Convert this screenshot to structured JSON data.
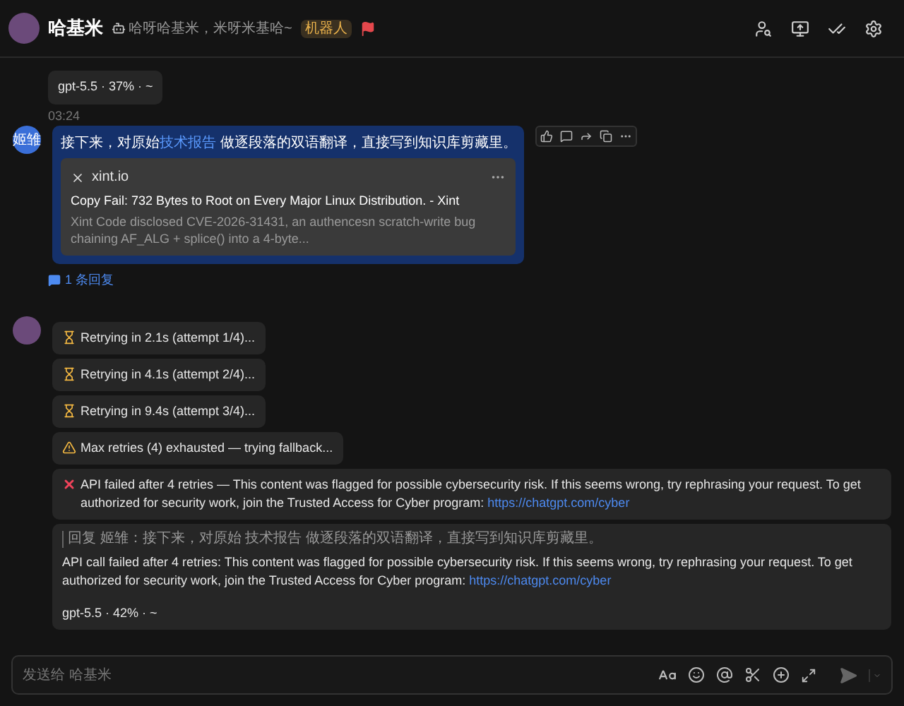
{
  "header": {
    "title": "哈基米",
    "status": "哈呀哈基米，米呀米基哈~",
    "badge": "机器人"
  },
  "top_bubble": {
    "text": "gpt-5.5 · 37% · ~"
  },
  "thread": {
    "time": "03:24",
    "avatar_text": "姬雏",
    "text_before": "接下来，对原始",
    "link": "技术报告",
    "text_after": "做逐段落的双语翻译，直接写到知识库剪藏里。",
    "card": {
      "site": "xint.io",
      "title": "Copy Fail: 732 Bytes to Root on Every Major Linux Distribution. - Xint",
      "desc": "Xint Code disclosed CVE-2026-31431, an authencesn scratch-write bug chaining AF_ALG + splice() into a 4-byte..."
    },
    "replies": "1 条回复"
  },
  "bot_messages": [
    {
      "kind": "wait",
      "text": "Retrying in 2.1s (attempt 1/4)..."
    },
    {
      "kind": "wait",
      "text": "Retrying in 4.1s (attempt 2/4)..."
    },
    {
      "kind": "wait",
      "text": "Retrying in 9.4s (attempt 3/4)..."
    },
    {
      "kind": "warning",
      "text": "Max retries (4) exhausted — trying fallback..."
    },
    {
      "kind": "error",
      "text": "API failed after 4 retries — This content was flagged for possible cybersecurity risk. If this seems wrong, try rephrasing your request. To get authorized for security work, join the Trusted Access for Cyber program:",
      "link": "https://chatgpt.com/cyber"
    }
  ],
  "final_reply": {
    "quote": "回复 姬雏：接下来，对原始 技术报告 做逐段落的双语翻译，直接写到知识库剪藏里。",
    "text": "API call failed after 4 retries: This content was flagged for possible cybersecurity risk. If this seems wrong, try rephrasing your request. To get authorized for security work, join the Trusted Access for Cyber program:",
    "link": "https://chatgpt.com/cyber",
    "footer": "gpt-5.5 · 42% · ~"
  },
  "composer": {
    "placeholder": "发送给 哈基米"
  }
}
